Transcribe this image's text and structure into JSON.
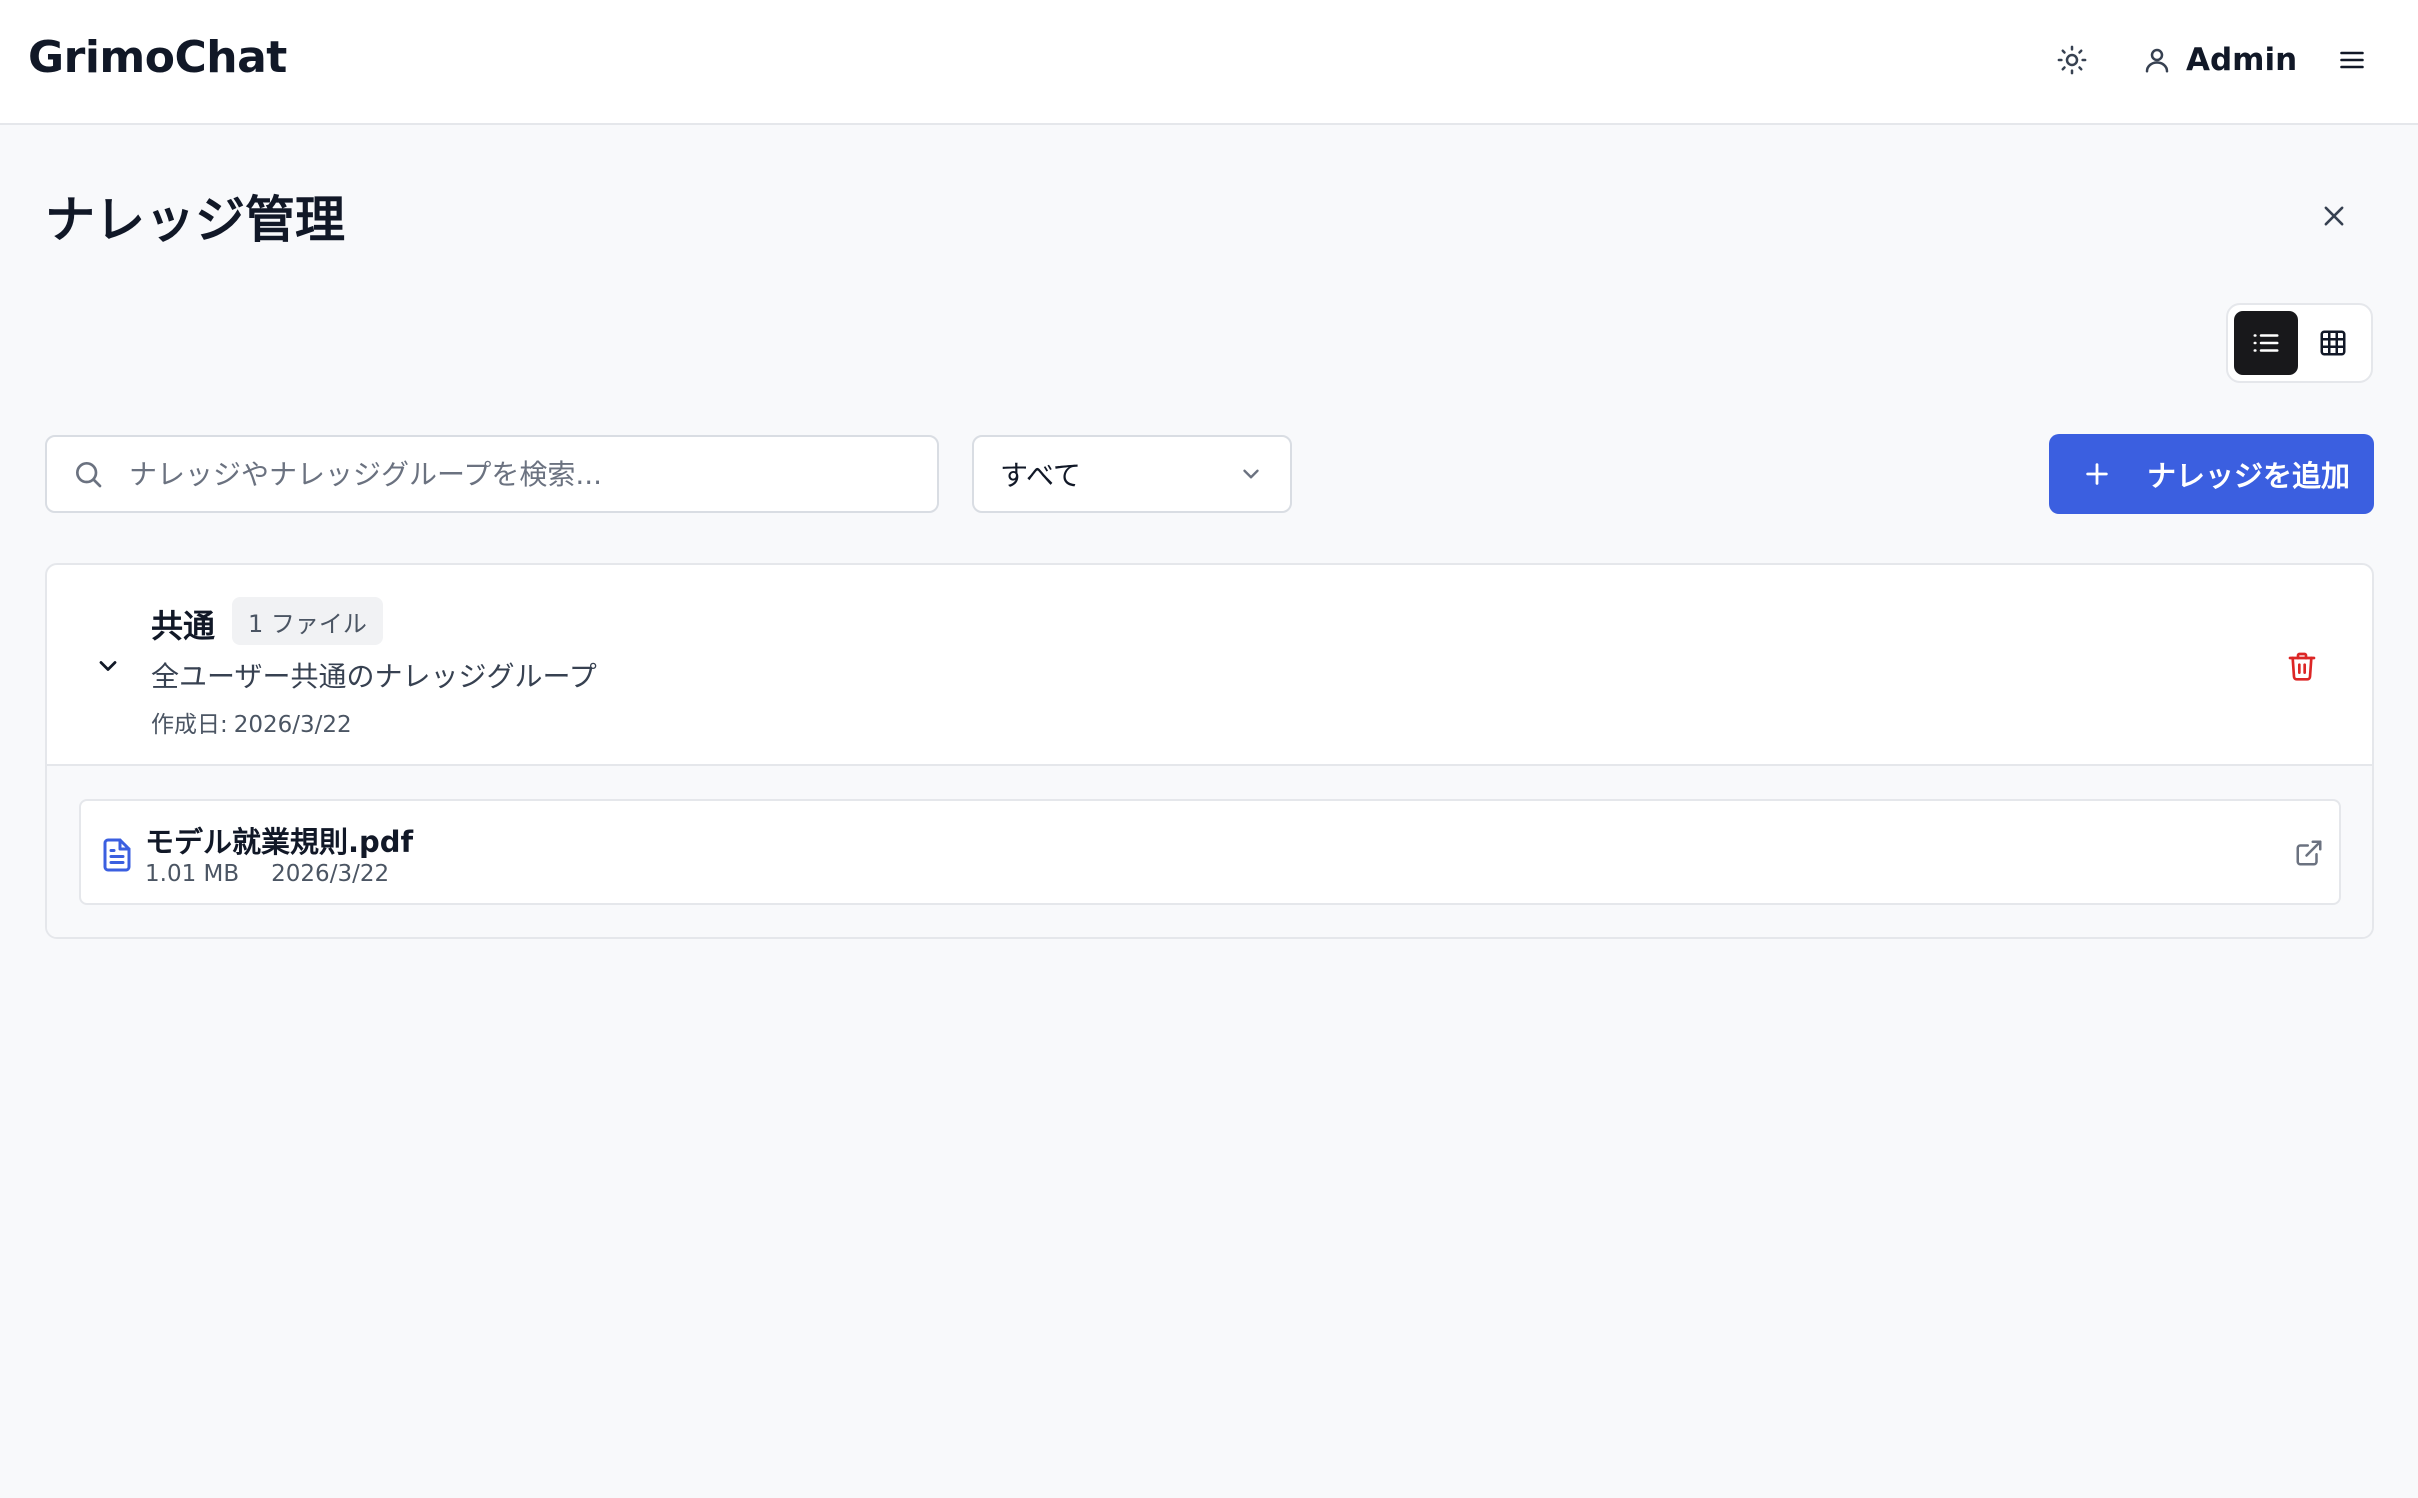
{
  "app": {
    "brand": "GrimoChat"
  },
  "header": {
    "user_label": "Admin",
    "icons": [
      "sun-icon",
      "user-icon",
      "hamburger-menu-icon"
    ]
  },
  "page": {
    "title": "ナレッジ管理"
  },
  "view_toggle": {
    "active": "list",
    "options": [
      "list",
      "grid"
    ]
  },
  "search": {
    "placeholder": "ナレッジやナレッジグループを検索...",
    "value": ""
  },
  "filter": {
    "selected": "すべて"
  },
  "add_button": {
    "label": "ナレッジを追加"
  },
  "groups": [
    {
      "name": "共通",
      "badge": "1 ファイル",
      "description": "全ユーザー共通のナレッジグループ",
      "created_label": "作成日:",
      "created_date": "2026/3/22",
      "expanded": true,
      "files": [
        {
          "name": "モデル就業規則.pdf",
          "size": "1.01 MB",
          "date": "2026/3/22"
        }
      ]
    }
  ],
  "colors": {
    "accent": "#3b5fe0",
    "danger": "#dc2626",
    "file_icon": "#3b5fe0",
    "toggle_active": "#18181b",
    "background": "#f8f9fb"
  }
}
